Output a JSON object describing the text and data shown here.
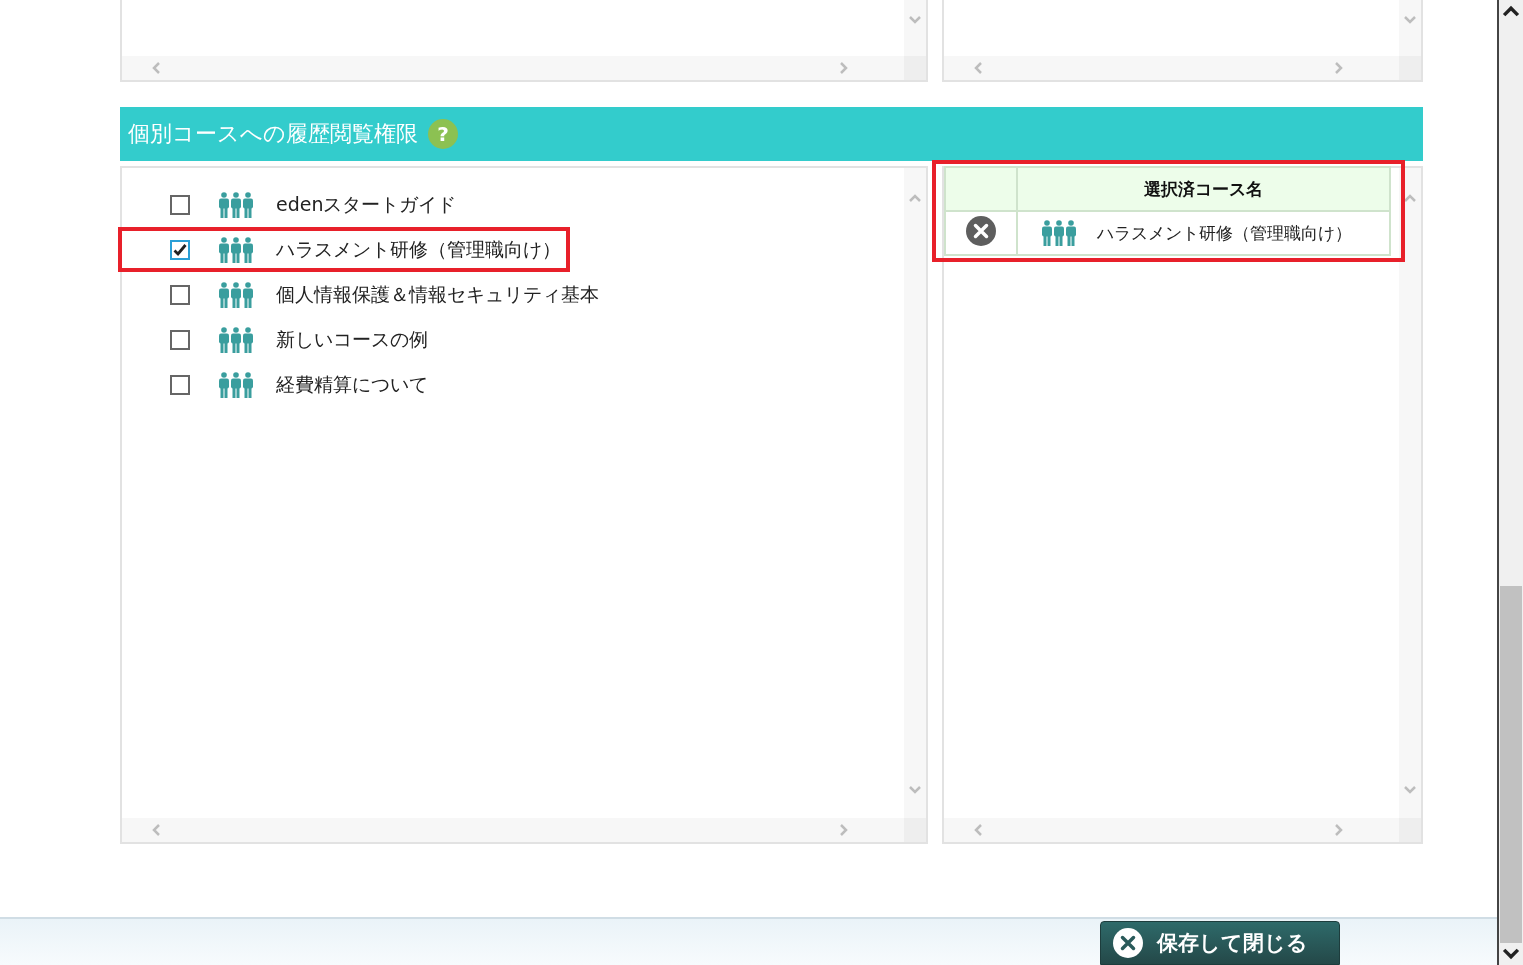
{
  "section": {
    "title": "個別コースへの履歴閲覧権限",
    "help": "?"
  },
  "courses": [
    {
      "name": "edenスタートガイド",
      "checked": false,
      "highlighted": false
    },
    {
      "name": "ハラスメント研修（管理職向け）",
      "checked": true,
      "highlighted": true
    },
    {
      "name": "個人情報保護＆情報セキュリティ基本",
      "checked": false,
      "highlighted": false
    },
    {
      "name": "新しいコースの例",
      "checked": false,
      "highlighted": false
    },
    {
      "name": "経費精算について",
      "checked": false,
      "highlighted": false
    }
  ],
  "selected_table": {
    "highlighted": true,
    "columns": [
      "選択済コース名"
    ],
    "rows": [
      {
        "name": "ハラスメント研修（管理職向け）"
      }
    ]
  },
  "footer": {
    "save_button": "保存して閉じる"
  }
}
